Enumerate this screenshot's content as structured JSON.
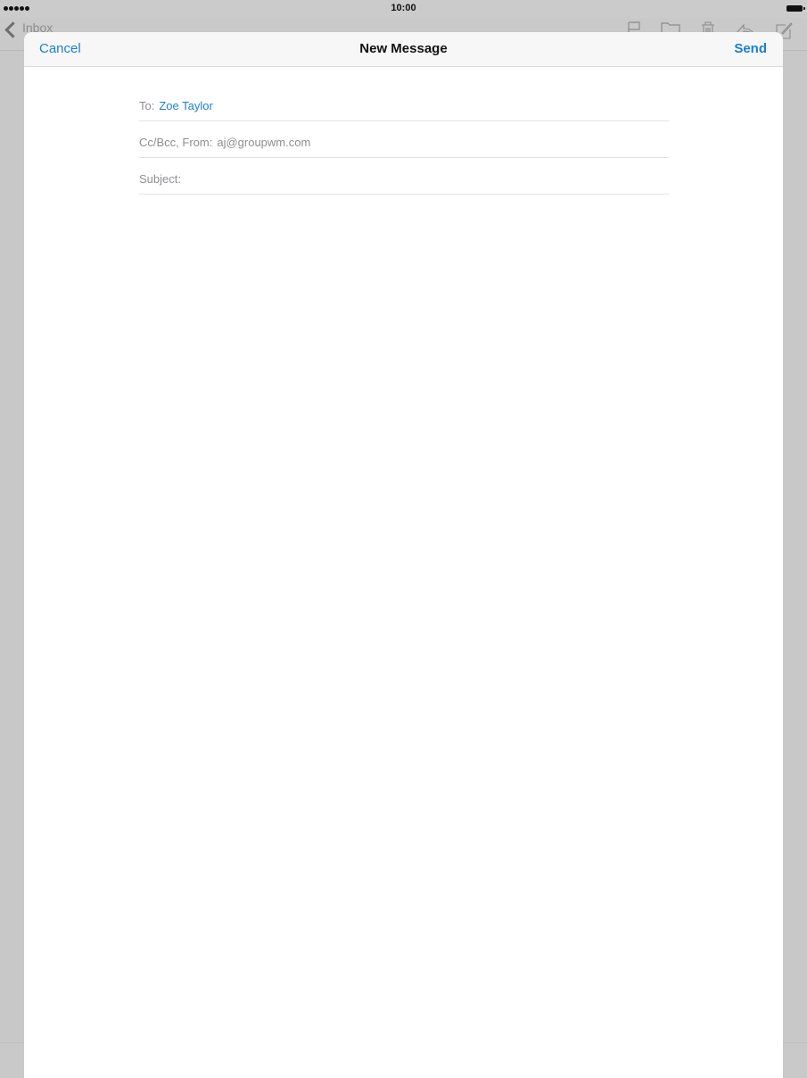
{
  "status_bar": {
    "time": "10:00"
  },
  "background": {
    "back_label": "Inbox"
  },
  "compose": {
    "cancel_label": "Cancel",
    "title": "New Message",
    "send_label": "Send",
    "to_label": "To:",
    "to_recipient": "Zoe Taylor",
    "ccbcc_label": "Cc/Bcc, From:",
    "from_address": "aj@groupwm.com",
    "subject_label": "Subject:"
  },
  "colors": {
    "accent": "#1a7fd4",
    "label_gray": "#8e8e93"
  },
  "icons": {
    "background_toolbar": [
      "flag-icon",
      "folder-icon",
      "trash-icon",
      "reply-icon",
      "compose-icon"
    ],
    "status": [
      "signal-icon",
      "battery-icon"
    ]
  }
}
